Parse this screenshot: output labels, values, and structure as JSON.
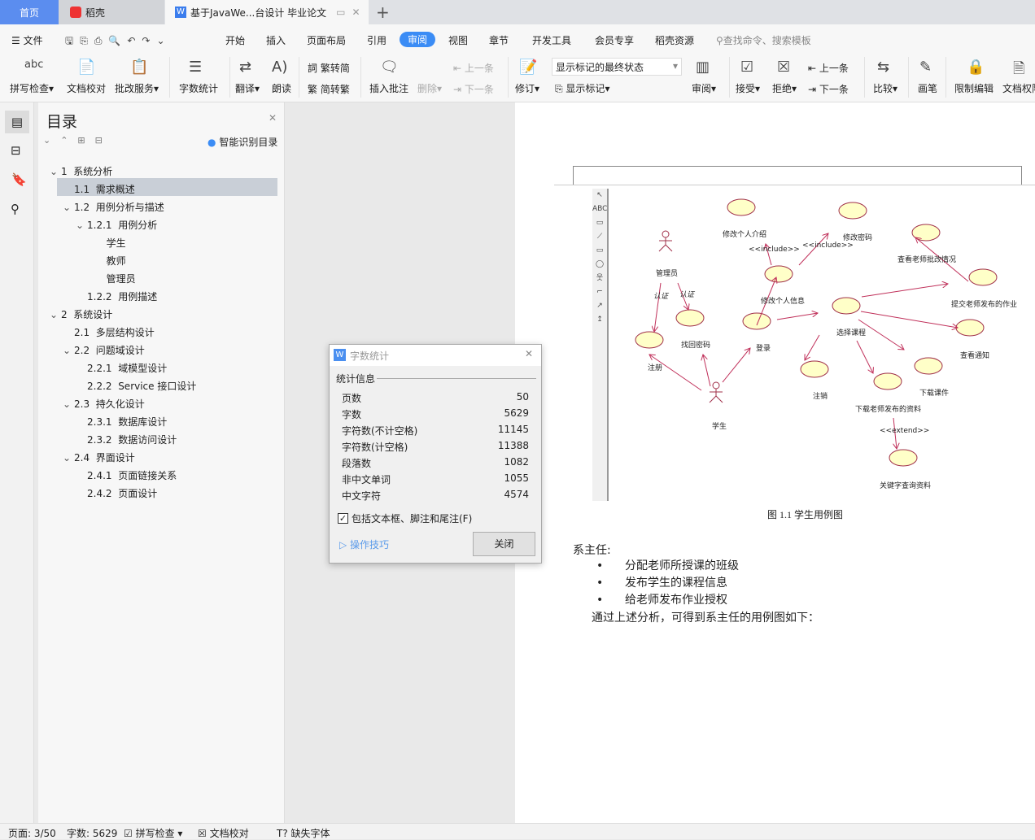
{
  "tabs": [
    {
      "label": "首页"
    },
    {
      "label": "稻壳"
    },
    {
      "label": "基于JavaWe...台设计 毕业论文"
    }
  ],
  "menu": {
    "file": "文件",
    "items": [
      "开始",
      "插入",
      "页面布局",
      "引用",
      "审阅",
      "视图",
      "章节",
      "开发工具",
      "会员专享",
      "稻壳资源"
    ],
    "active": "审阅",
    "search_placeholder": "查找命令、搜索模板"
  },
  "ribbon": {
    "spell": "拼写检查",
    "proof": "文档校对",
    "correct": "批改服务",
    "wordcount": "字数统计",
    "translate": "翻译",
    "read": "朗读",
    "t2s": "繁转简",
    "s2t": "简转繁",
    "insert_comment": "插入批注",
    "delete": "删除",
    "prev": "上一条",
    "next": "下一条",
    "revise": "修订",
    "markup_state": "显示标记的最终状态",
    "show_markup": "显示标记",
    "review": "审阅",
    "accept": "接受",
    "reject": "拒绝",
    "prev2": "上一条",
    "next2": "下一条",
    "compare": "比较",
    "pen": "画笔",
    "restrict": "限制编辑",
    "perm": "文档权限",
    "abc": "abc"
  },
  "nav": {
    "title": "目录",
    "smart": "智能识别目录",
    "items": [
      {
        "num": "1",
        "text": "系统分析"
      },
      {
        "num": "1.1",
        "text": "需求概述"
      },
      {
        "num": "1.2",
        "text": "用例分析与描述"
      },
      {
        "num": "1.2.1",
        "text": "用例分析"
      },
      {
        "num": "",
        "text": "学生"
      },
      {
        "num": "",
        "text": "教师"
      },
      {
        "num": "",
        "text": "管理员"
      },
      {
        "num": "1.2.2",
        "text": "用例描述"
      },
      {
        "num": "2",
        "text": "系统设计"
      },
      {
        "num": "2.1",
        "text": "多层结构设计"
      },
      {
        "num": "2.2",
        "text": "问题域设计"
      },
      {
        "num": "2.2.1",
        "text": "域模型设计"
      },
      {
        "num": "2.2.2",
        "text": "Service 接口设计"
      },
      {
        "num": "2.3",
        "text": "持久化设计"
      },
      {
        "num": "2.3.1",
        "text": "数据库设计"
      },
      {
        "num": "2.3.2",
        "text": "数据访问设计"
      },
      {
        "num": "2.4",
        "text": "界面设计"
      },
      {
        "num": "2.4.1",
        "text": "页面链接关系"
      },
      {
        "num": "2.4.2",
        "text": "页面设计"
      }
    ]
  },
  "dialog": {
    "title": "字数统计",
    "section": "统计信息",
    "stats": [
      {
        "k": "页数",
        "v": "50"
      },
      {
        "k": "字数",
        "v": "5629"
      },
      {
        "k": "字符数(不计空格)",
        "v": "11145"
      },
      {
        "k": "字符数(计空格)",
        "v": "11388"
      },
      {
        "k": "段落数",
        "v": "1082"
      },
      {
        "k": "非中文单词",
        "v": "1055"
      },
      {
        "k": "中文字符",
        "v": "4574"
      }
    ],
    "checkbox": "包括文本框、脚注和尾注(F)",
    "checked": true,
    "tips": "操作技巧",
    "close": "关闭"
  },
  "diagram": {
    "labels": [
      "修改个人介绍",
      "修改密码",
      "查看老师批改情况",
      "提交老师发布的作业",
      "管理员",
      "修改个人信息",
      "选择课程",
      "登录",
      "找回密码",
      "注册",
      "查看通知",
      "下载课件",
      "注销",
      "下载老师发布的资料",
      "学生",
      "关键字查询资料",
      "<<include>>",
      "<<include>>",
      "<<extend>>",
      "认证",
      "认证"
    ],
    "toolbar_abc": "ABC"
  },
  "doc": {
    "caption": "图 1.1 学生用例图",
    "heading": "系主任:",
    "bullets": [
      "分配老师所授课的班级",
      "发布学生的课程信息",
      "给老师发布作业授权"
    ],
    "para": "通过上述分析，可得到系主任的用例图如下："
  },
  "status": {
    "page": "页面: 3/50",
    "words": "字数: 5629",
    "spell": "拼写检查",
    "proof": "文档校对",
    "font": "缺失字体"
  },
  "colors": {
    "accent": "#3b8cf5",
    "ellipse": "#ffffc8",
    "arrow": "#c0305a"
  }
}
